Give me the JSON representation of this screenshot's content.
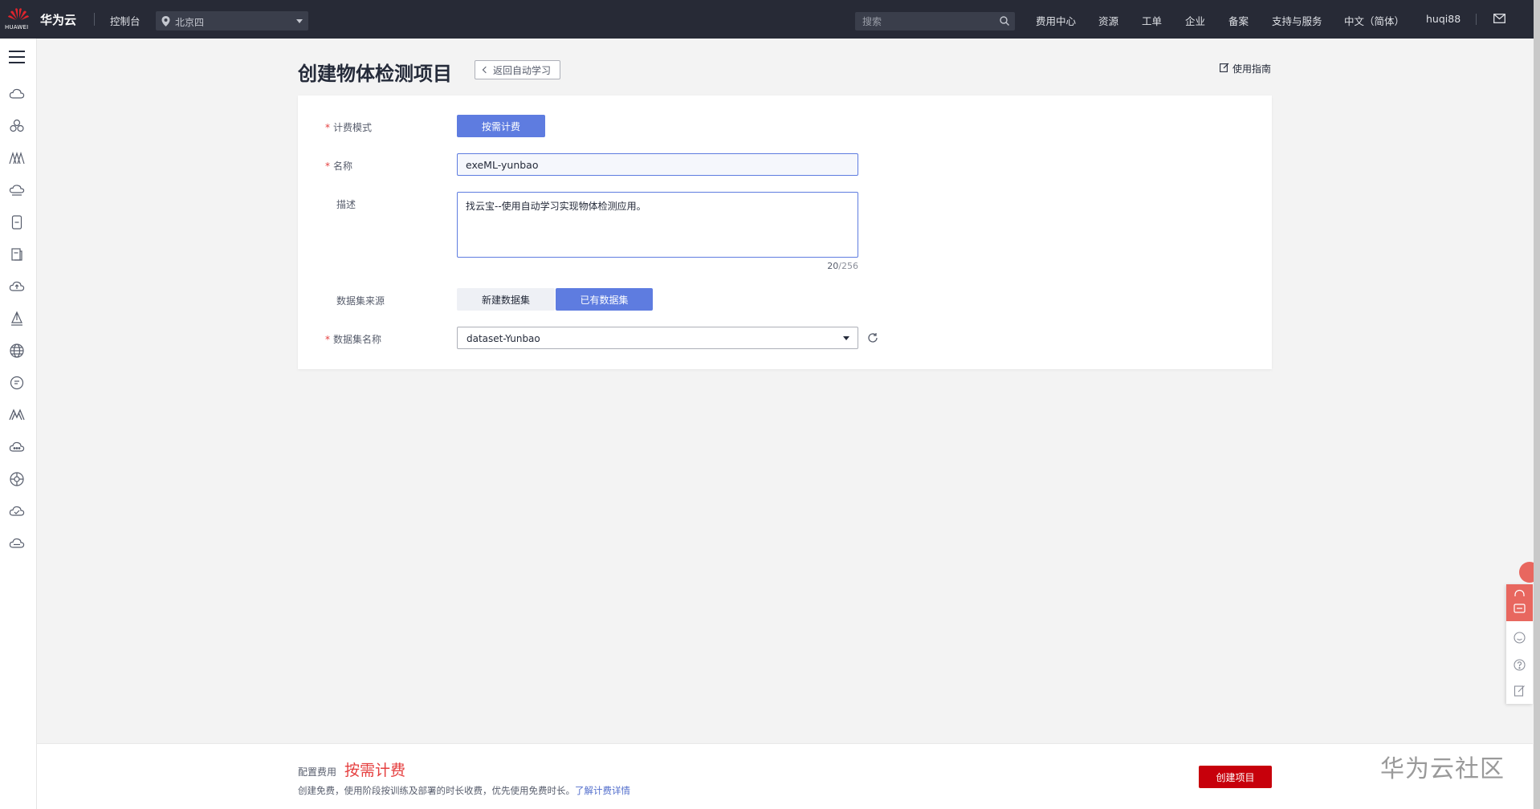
{
  "topbar": {
    "logo_text": "HUAWEI",
    "brand": "华为云",
    "console": "控制台",
    "region": "北京四",
    "search_placeholder": "搜索",
    "nav": [
      "费用中心",
      "资源",
      "工单",
      "企业",
      "备案",
      "支持与服务",
      "中文（简体）",
      "huqi88"
    ]
  },
  "page": {
    "title": "创建物体检测项目",
    "back_label": "返回自动学习",
    "guide_label": "使用指南"
  },
  "form": {
    "billing_label": "计费模式",
    "billing_value": "按需计费",
    "name_label": "名称",
    "name_value": "exeML-yunbao",
    "desc_label": "描述",
    "desc_value": "找云宝--使用自动学习实现物体检测应用。",
    "desc_count": "20",
    "desc_max": "/256",
    "source_label": "数据集来源",
    "source_options": [
      "新建数据集",
      "已有数据集"
    ],
    "source_selected": "已有数据集",
    "dataset_label": "数据集名称",
    "dataset_value": "dataset-Yunbao"
  },
  "footer": {
    "fee_label": "配置费用",
    "fee_value": "按需计费",
    "fee_note": "创建免费，使用阶段按训练及部署的时长收费，优先使用免费时长。",
    "fee_link": "了解计费详情",
    "create_label": "创建项目",
    "watermark": "华为云社区"
  },
  "colors": {
    "topbar": "#272a36",
    "primary": "#5e7ce0",
    "danger": "#c7000b",
    "required": "#e53e3e"
  },
  "icons": {
    "sidebar": [
      "cloud-icon",
      "cluster-icon",
      "mountain-icon",
      "cloud-stack-icon",
      "document-icon",
      "file-copy-icon",
      "cloud-up-icon",
      "flask-icon",
      "globe-icon",
      "chat-circle-icon",
      "model-arts-icon",
      "cloud-dots-icon",
      "gear-network-icon",
      "cloud-check-icon",
      "cloud-more-icon"
    ]
  }
}
